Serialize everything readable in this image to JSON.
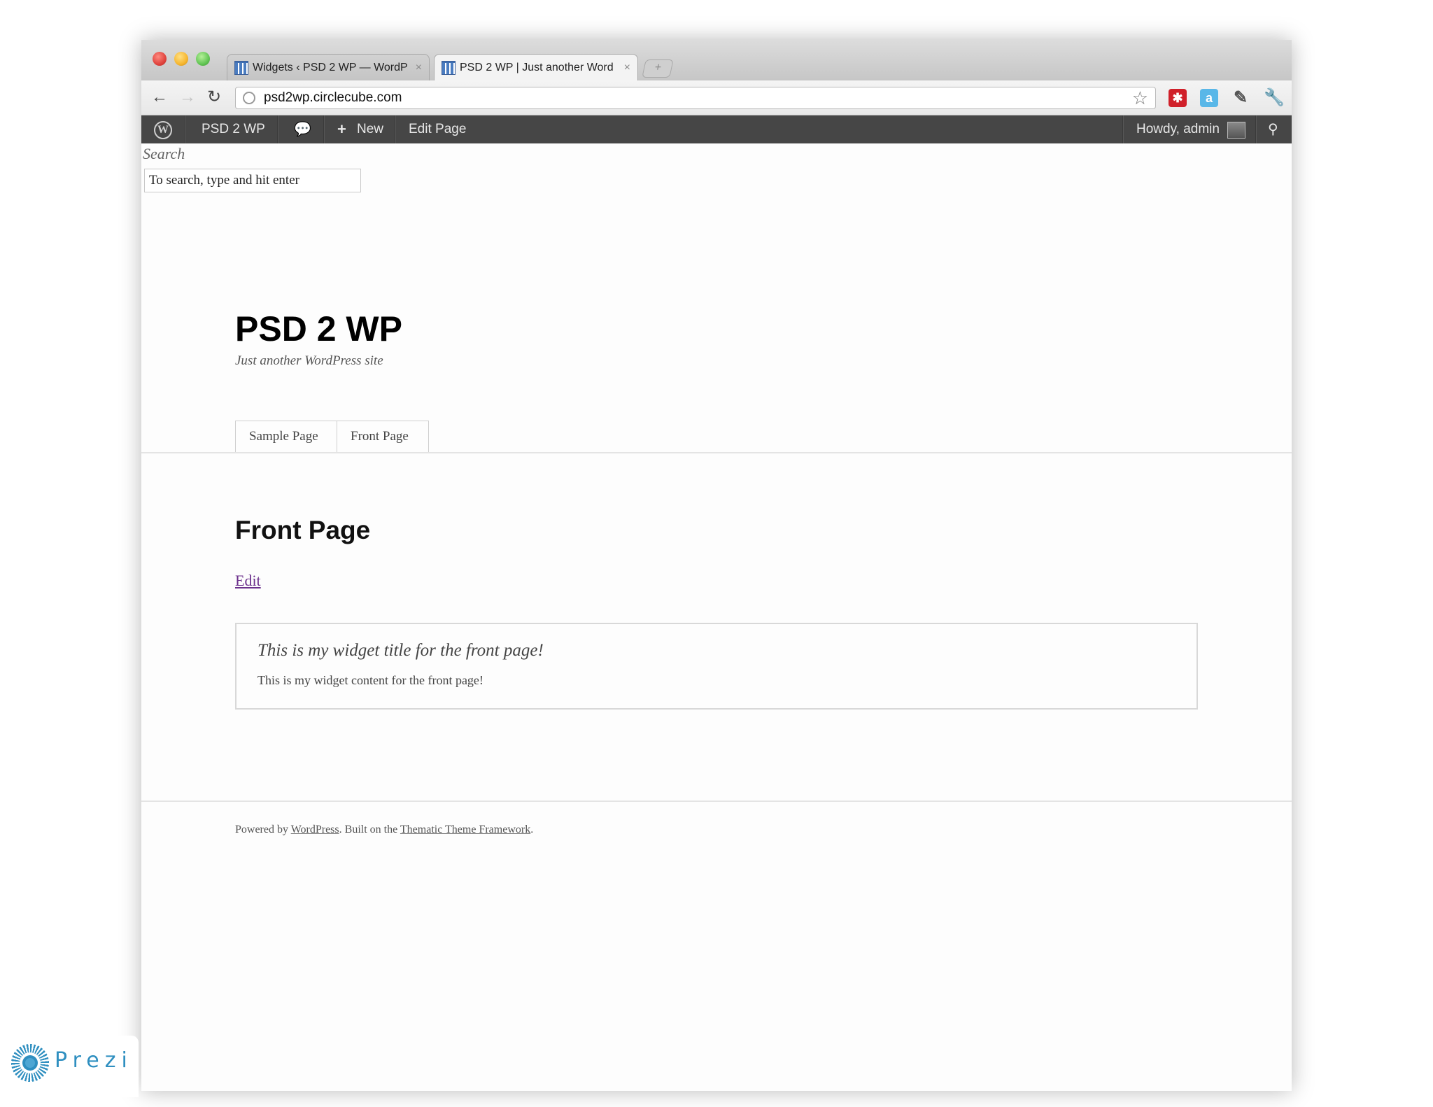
{
  "browser": {
    "tabs": [
      {
        "title": "Widgets ‹ PSD 2 WP — WordP"
      },
      {
        "title": "PSD 2 WP | Just another Word"
      }
    ],
    "tab_close_glyph": "×",
    "new_tab_glyph": "+",
    "url": "psd2wp.circlecube.com",
    "icons": {
      "back": "back-arrow-icon",
      "forward": "forward-arrow-icon",
      "reload": "reload-icon",
      "bookmark": "star-icon",
      "wrench": "wrench-icon"
    }
  },
  "admin_bar": {
    "site_name": "PSD 2 WP",
    "new_label": "New",
    "edit_page_label": "Edit Page",
    "howdy": "Howdy, admin"
  },
  "search": {
    "label": "Search",
    "value": "To search, type and hit enter"
  },
  "site": {
    "title": "PSD 2 WP",
    "description": "Just another WordPress site"
  },
  "nav": {
    "items": [
      {
        "label": "Sample Page"
      },
      {
        "label": "Front Page"
      }
    ]
  },
  "entry": {
    "title": "Front Page",
    "edit_label": "Edit"
  },
  "widget": {
    "title": "This is my widget title for the front page!",
    "content": "This is my widget content for the front page!"
  },
  "footer": {
    "powered_by": "Powered by ",
    "wordpress_link": "WordPress",
    "built_on": ". Built on the ",
    "framework_link": "Thematic Theme Framework",
    "end": "."
  },
  "watermark": {
    "brand": "Prezi"
  },
  "colors": {
    "admin_bar": "#464646",
    "link_visited": "#6b2f8c",
    "prezi_blue": "#2f8fc0"
  }
}
